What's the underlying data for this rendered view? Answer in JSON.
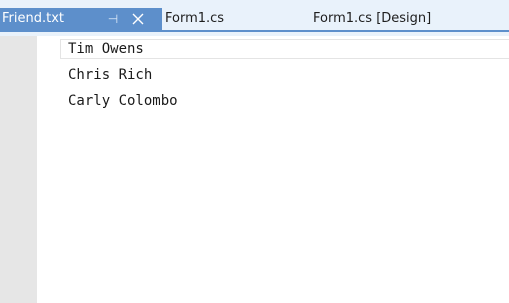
{
  "tabs": [
    {
      "label": "Friend.txt",
      "active": true,
      "pinned": true,
      "closable": true
    },
    {
      "label": "Form1.cs",
      "active": false
    },
    {
      "label": "Form1.cs [Design]",
      "active": false
    }
  ],
  "icons": {
    "pin": "pin-icon",
    "close": "close-icon"
  },
  "editor": {
    "lines": [
      "Tim Owens",
      "Chris Rich",
      "Carly Colombo"
    ]
  },
  "colors": {
    "active_tab": "#5d8fcb",
    "tabstrip_bg": "#e9f2fb",
    "gutter": "#e6e6e6"
  }
}
